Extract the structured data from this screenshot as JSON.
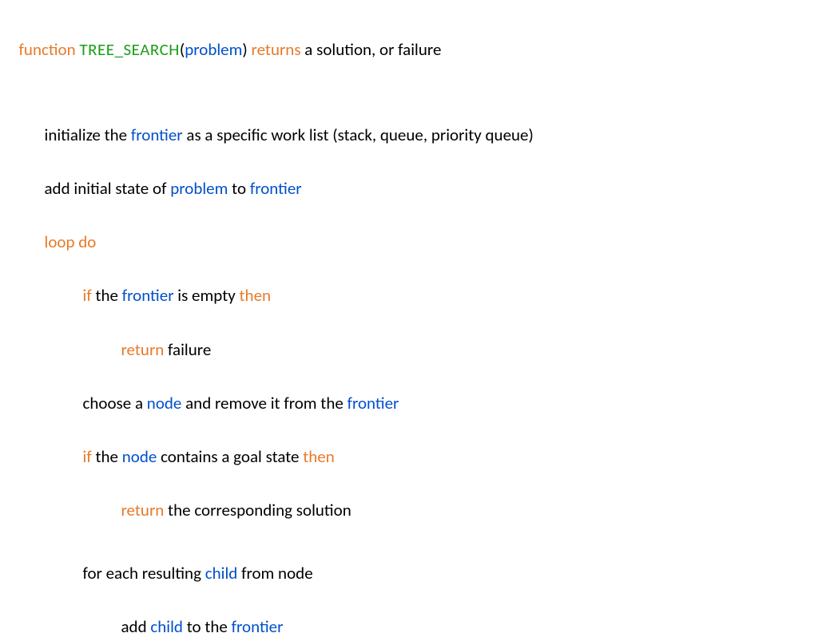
{
  "sig": {
    "kw_function": "function ",
    "name": "TREE_SEARCH",
    "lparen": "(",
    "arg": "problem",
    "rparen": ") ",
    "kw_returns": "returns",
    "tail": " a solution, or failure"
  },
  "l1": {
    "a": "initialize the ",
    "b": "frontier",
    "c": " as a specific work list (stack, queue, priority queue)"
  },
  "l2": {
    "a": "add initial state of ",
    "b": "problem",
    "c": " to ",
    "d": "frontier"
  },
  "l3": {
    "a": "loop do"
  },
  "l4": {
    "a": "if",
    "b": " the ",
    "c": "frontier",
    "d": " is empty ",
    "e": "then"
  },
  "l5": {
    "a": "return",
    "b": " failure"
  },
  "l6": {
    "a": "choose a ",
    "b": "node",
    "c": " and remove it from the ",
    "d": "frontier"
  },
  "l7": {
    "a": "if",
    "b": " the ",
    "c": "node",
    "d": " contains a goal state ",
    "e": "then"
  },
  "l8": {
    "a": "return",
    "b": " the corresponding solution"
  },
  "l9": {
    "a": "for each resulting ",
    "b": "child ",
    "c": "from node"
  },
  "l10": {
    "a": "add ",
    "b": "child",
    "c": " to the ",
    "d": "frontier"
  }
}
